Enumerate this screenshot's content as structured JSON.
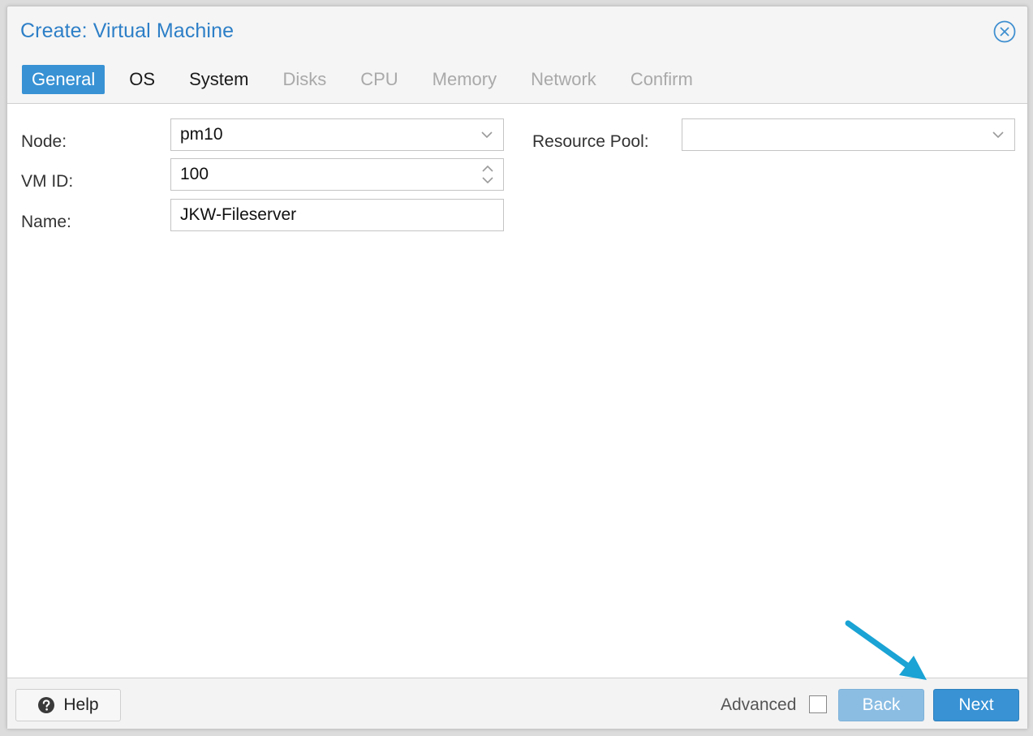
{
  "dialog": {
    "title": "Create: Virtual Machine"
  },
  "tabs": [
    {
      "label": "General",
      "state": "active"
    },
    {
      "label": "OS",
      "state": "enabled"
    },
    {
      "label": "System",
      "state": "enabled"
    },
    {
      "label": "Disks",
      "state": "disabled"
    },
    {
      "label": "CPU",
      "state": "disabled"
    },
    {
      "label": "Memory",
      "state": "disabled"
    },
    {
      "label": "Network",
      "state": "disabled"
    },
    {
      "label": "Confirm",
      "state": "disabled"
    }
  ],
  "form": {
    "node_label": "Node:",
    "node_value": "pm10",
    "vmid_label": "VM ID:",
    "vmid_value": "100",
    "name_label": "Name:",
    "name_value": "JKW-Fileserver",
    "pool_label": "Resource Pool:",
    "pool_value": ""
  },
  "footer": {
    "help_label": "Help",
    "advanced_label": "Advanced",
    "advanced_checked": false,
    "back_label": "Back",
    "next_label": "Next"
  },
  "colors": {
    "accent": "#3892d4",
    "title": "#2d7fc7",
    "annotation_arrow": "#1aa3d4"
  },
  "icons": {
    "close": "close-circle-icon",
    "help": "question-circle-icon",
    "dropdown": "chevron-down-icon",
    "spinner": "spinner-arrows-icon",
    "annotation": "annotation-arrow-icon"
  }
}
